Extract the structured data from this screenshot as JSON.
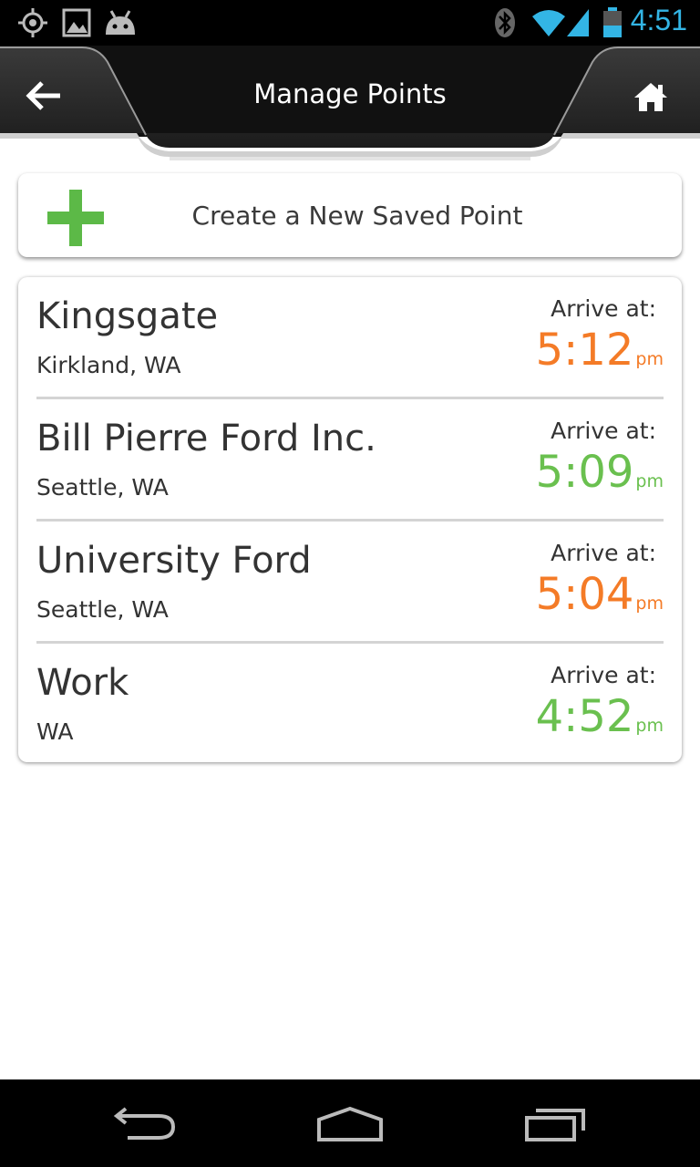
{
  "status_bar": {
    "time": "4:51",
    "icons": [
      "gps-icon",
      "picture-icon",
      "android-icon",
      "bluetooth-icon",
      "wifi-icon",
      "signal-icon",
      "battery-icon"
    ],
    "time_color": "#33b5e5"
  },
  "action_bar": {
    "title": "Manage Points",
    "back_icon": "back-arrow-icon",
    "home_icon": "home-icon"
  },
  "create_button": {
    "label": "Create a New Saved Point",
    "icon": "plus-icon",
    "icon_color": "#5cb947"
  },
  "points": [
    {
      "name": "Kingsgate",
      "location": "Kirkland, WA",
      "arrive_label": "Arrive at:",
      "time": "5:12",
      "ampm": "pm",
      "status_color": "#f47b27"
    },
    {
      "name": "Bill Pierre Ford Inc.",
      "location": "Seattle, WA",
      "arrive_label": "Arrive at:",
      "time": "5:09",
      "ampm": "pm",
      "status_color": "#6ac04f"
    },
    {
      "name": "University Ford",
      "location": "Seattle, WA",
      "arrive_label": "Arrive at:",
      "time": "5:04",
      "ampm": "pm",
      "status_color": "#f47b27"
    },
    {
      "name": "Work",
      "location": "WA",
      "arrive_label": "Arrive at:",
      "time": "4:52",
      "ampm": "pm",
      "status_color": "#6ac04f"
    }
  ],
  "nav_bar": {
    "buttons": [
      "back-nav-icon",
      "home-nav-icon",
      "recent-apps-icon"
    ]
  }
}
